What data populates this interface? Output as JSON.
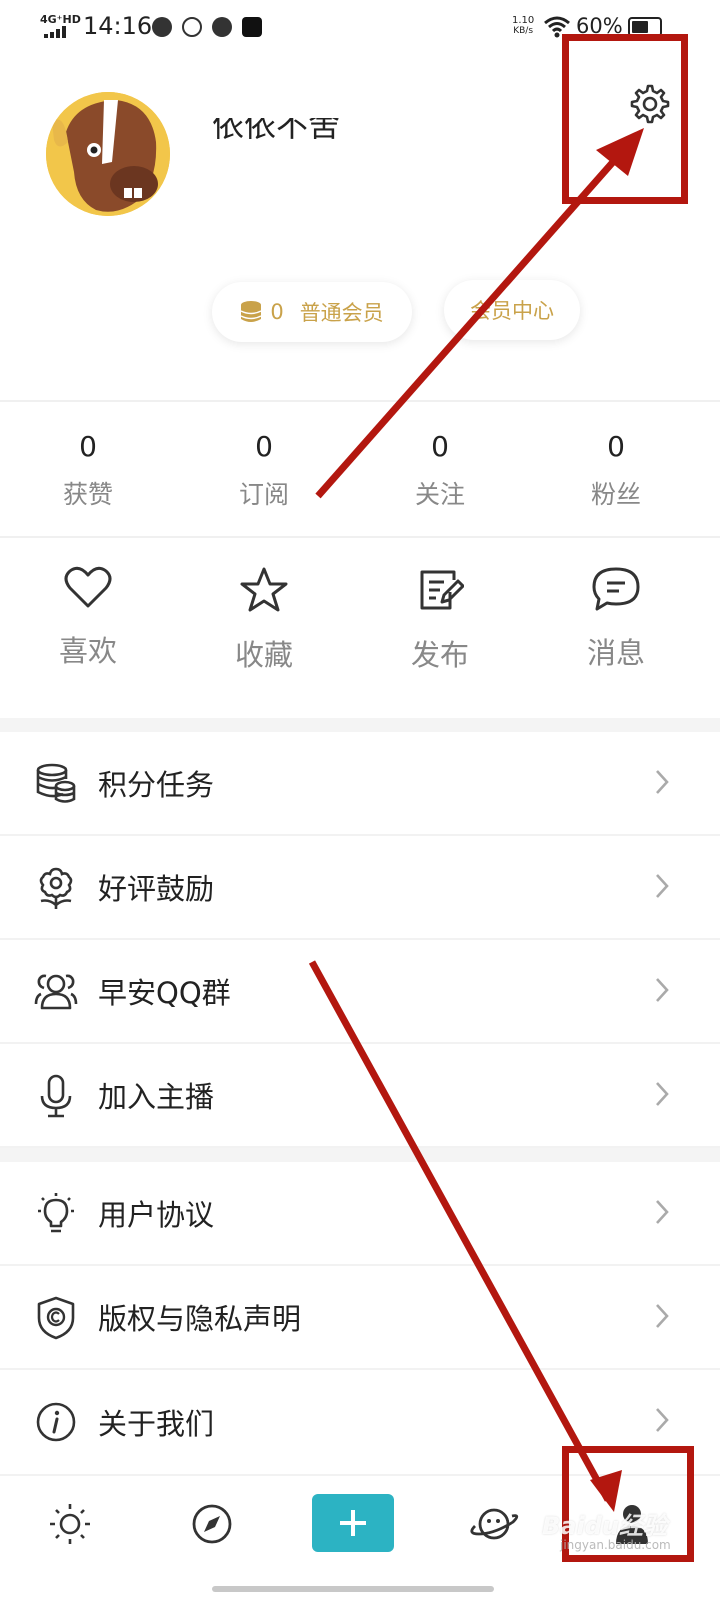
{
  "status_bar": {
    "network": "4G⁺HD",
    "time": "14:16",
    "speed_value": "1.10",
    "speed_unit": "KB/s",
    "battery": "60%"
  },
  "profile": {
    "username": "依依不舍",
    "coins": "0",
    "level": "普通会员",
    "vip_center": "会员中心"
  },
  "stats": [
    {
      "value": "0",
      "label": "获赞"
    },
    {
      "value": "0",
      "label": "订阅"
    },
    {
      "value": "0",
      "label": "关注"
    },
    {
      "value": "0",
      "label": "粉丝"
    }
  ],
  "actions": [
    {
      "label": "喜欢",
      "icon": "heart-icon"
    },
    {
      "label": "收藏",
      "icon": "star-icon"
    },
    {
      "label": "发布",
      "icon": "edit-icon"
    },
    {
      "label": "消息",
      "icon": "message-icon"
    }
  ],
  "menu_group_1": [
    {
      "label": "积分任务",
      "icon": "coins-stack-icon"
    },
    {
      "label": "好评鼓励",
      "icon": "flower-icon"
    },
    {
      "label": "早安QQ群",
      "icon": "group-icon"
    },
    {
      "label": "加入主播",
      "icon": "microphone-icon"
    }
  ],
  "menu_group_2": [
    {
      "label": "用户协议",
      "icon": "lightbulb-icon"
    },
    {
      "label": "版权与隐私声明",
      "icon": "shield-copyright-icon"
    },
    {
      "label": "关于我们",
      "icon": "info-icon"
    }
  ],
  "bottom_nav": [
    "sun-icon",
    "compass-icon",
    "plus-icon",
    "planet-icon",
    "profile-icon"
  ],
  "watermark": {
    "text": "Baidu经验",
    "sub": "jingyan.baidu.com"
  },
  "colors": {
    "gold": "#c9a24a",
    "accent": "#2cb3c3",
    "annotation": "#b3170f"
  }
}
